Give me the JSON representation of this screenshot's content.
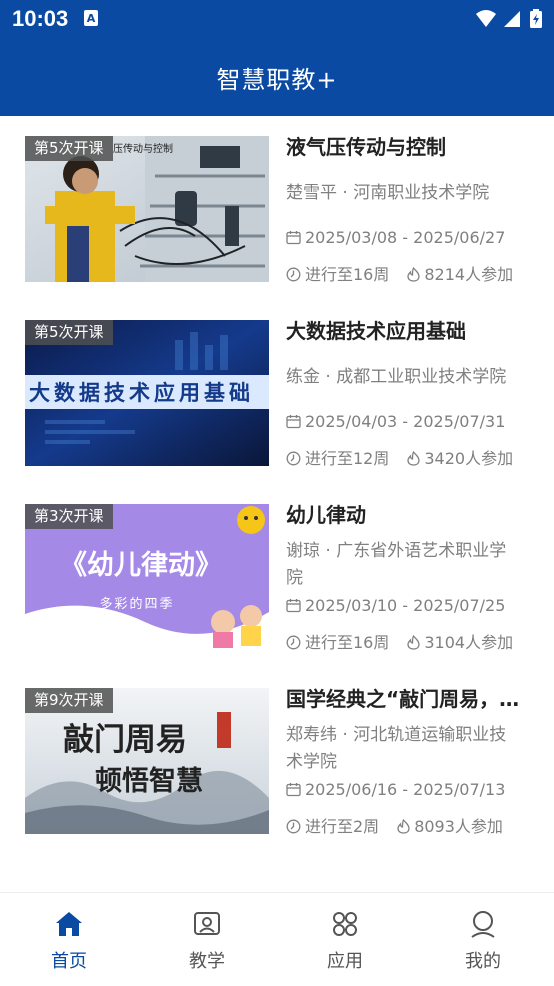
{
  "status_bar": {
    "time": "10:03"
  },
  "app": {
    "title": "智慧职教+"
  },
  "courses": [
    {
      "badge": "第5次开课",
      "title": "液气压传动与控制",
      "teacher": "楚雪平 · 河南职业技术学院",
      "dates": "2025/03/08 - 2025/06/27",
      "progress": "进行至16周",
      "participants": "8214人参加",
      "thumb_text": "压传动与控制"
    },
    {
      "badge": "第5次开课",
      "title": "大数据技术应用基础",
      "teacher": "练金 · 成都工业职业技术学院",
      "dates": "2025/04/03 - 2025/07/31",
      "progress": "进行至12周",
      "participants": "3420人参加",
      "thumb_text": "大数据技术应用基础"
    },
    {
      "badge": "第3次开课",
      "title": "幼儿律动",
      "teacher": "谢琼 · 广东省外语艺术职业学院",
      "dates": "2025/03/10 - 2025/07/25",
      "progress": "进行至16周",
      "participants": "3104人参加",
      "thumb_text": "《幼儿律动》",
      "thumb_subtext": "多彩的四季"
    },
    {
      "badge": "第9次开课",
      "title": "国学经典之“敲门周易，顿悟智慧”",
      "teacher": "郑寿纬 · 河北轨道运输职业技术学院",
      "dates": "2025/06/16 - 2025/07/13",
      "progress": "进行至2周",
      "participants": "8093人参加",
      "thumb_text": "敲门周易",
      "thumb_text2": "顿悟智慧"
    }
  ],
  "tabs": [
    {
      "label": "首页",
      "icon": "home-icon",
      "active": true
    },
    {
      "label": "教学",
      "icon": "teaching-icon",
      "active": false
    },
    {
      "label": "应用",
      "icon": "apps-icon",
      "active": false
    },
    {
      "label": "我的",
      "icon": "profile-icon",
      "active": false
    }
  ],
  "colors": {
    "primary": "#0a4aa3",
    "text_secondary": "#808080"
  }
}
